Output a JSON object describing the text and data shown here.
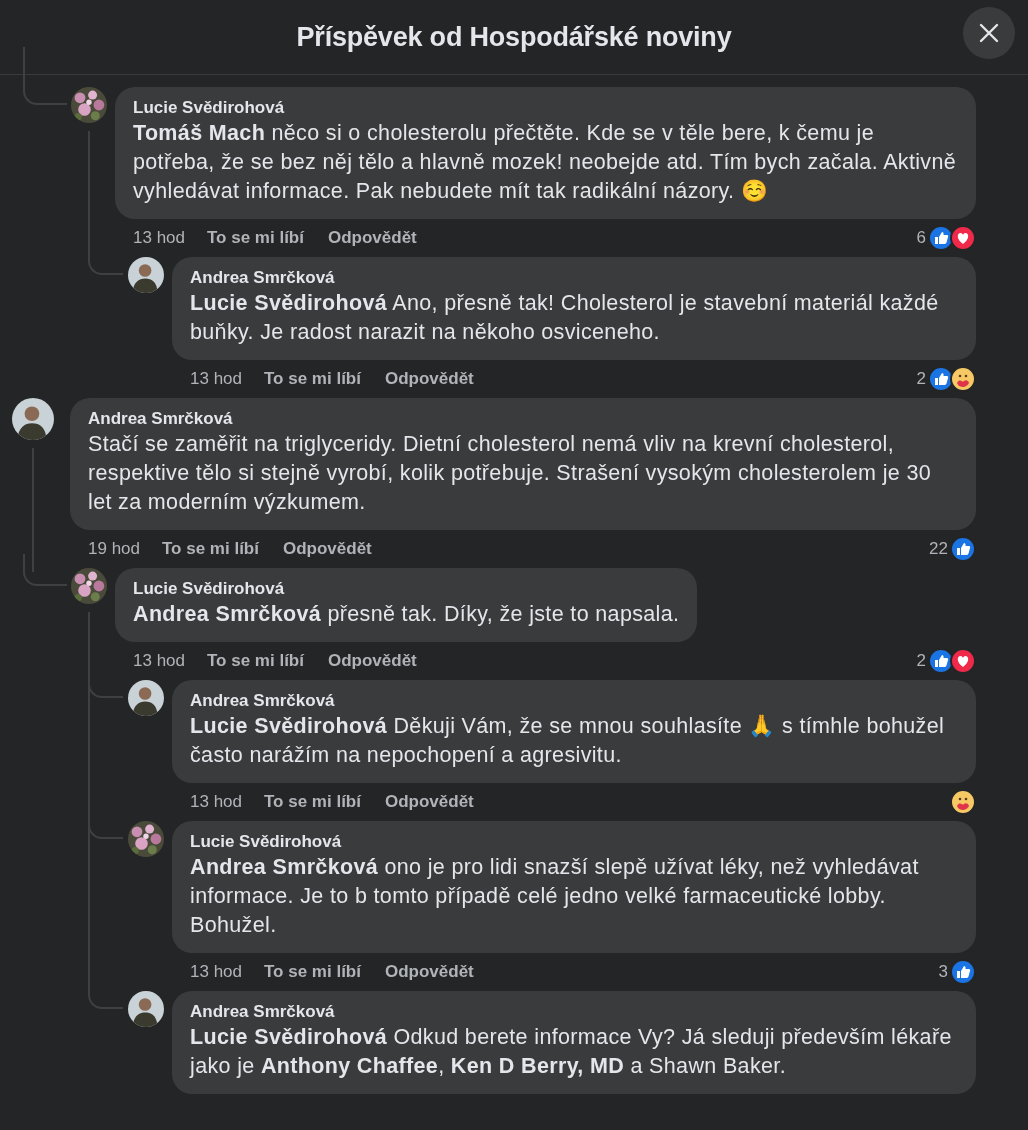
{
  "header": {
    "title": "Příspěvek od Hospodářské noviny"
  },
  "comments": [
    {
      "kind": "continued",
      "children": [
        {
          "kind": "comment",
          "avatar": {
            "kind": "flowers"
          },
          "author": "Lucie Svědirohová",
          "text": "**Tomáš Mach** něco si o cholesterolu přečtěte. Kde se v těle bere, k čemu je potřeba, že se bez něj tělo a hlavně mozek! neobejde atd. Tím bych začala. Aktivně vyhledávat informace. Pak nebudete mít tak radikální názory. ☺️",
          "time": "13 hod",
          "like": "To se mi líbí",
          "reply": "Odpovědět",
          "count": "6",
          "reactions": [
            {
              "kind": "like"
            },
            {
              "kind": "love"
            }
          ],
          "children": [
            {
              "kind": "comment",
              "avatar": {
                "kind": "person"
              },
              "author": "Andrea Smrčková",
              "text": "**Lucie Svědirohová** Ano, přesně tak! Cholesterol je stavební materiál každé buňky. Je radost narazit na někoho osviceneho.",
              "time": "13 hod",
              "like": "To se mi líbí",
              "reply": "Odpovědět",
              "count": "2",
              "reactions": [
                {
                  "kind": "like"
                },
                {
                  "kind": "care"
                }
              ]
            }
          ]
        }
      ]
    },
    {
      "kind": "comment",
      "avatar": {
        "kind": "person"
      },
      "author": "Andrea Smrčková",
      "text": "Stačí se zaměřit na triglyceridy. Dietní cholesterol nemá vliv na krevní cholesterol, respektive tělo si stejně vyrobí, kolik potřebuje. Strašení vysokým cholesterolem je 30 let za moderním výzkumem.",
      "time": "19 hod",
      "like": "To se mi líbí",
      "reply": "Odpovědět",
      "count": "22",
      "reactions": [
        {
          "kind": "like"
        }
      ],
      "children": [
        {
          "kind": "comment",
          "avatar": {
            "kind": "flowers"
          },
          "author": "Lucie Svědirohová",
          "text": "**Andrea Smrčková** přesně tak. Díky, že jste to napsala.",
          "time": "13 hod",
          "like": "To se mi líbí",
          "reply": "Odpovědět",
          "count": "2",
          "reactions": [
            {
              "kind": "like"
            },
            {
              "kind": "love"
            }
          ],
          "children": [
            {
              "kind": "comment",
              "avatar": {
                "kind": "person"
              },
              "author": "Andrea Smrčková",
              "text": "**Lucie Svědirohová** Děkuji Vám, že se mnou souhlasíte 🙏 s tímhle bohužel často narážím na nepochopení a agresivitu.",
              "time": "13 hod",
              "like": "To se mi líbí",
              "reply": "Odpovědět",
              "reactions": [
                {
                  "kind": "care"
                }
              ]
            },
            {
              "kind": "comment",
              "avatar": {
                "kind": "flowers"
              },
              "author": "Lucie Svědirohová",
              "text": "**Andrea Smrčková** ono je pro lidi snazší slepě užívat léky, než vyhledávat informace. Je to b tomto případě celé jedno velké farmaceutické lobby. Bohužel.",
              "time": "13 hod",
              "like": "To se mi líbí",
              "reply": "Odpovědět",
              "count": "3",
              "reactions": [
                {
                  "kind": "like"
                }
              ]
            },
            {
              "kind": "comment",
              "avatar": {
                "kind": "person"
              },
              "author": "Andrea Smrčková",
              "text": "**Lucie Svědirohová** Odkud berete informace Vy? Já sleduji především lékaře jako je **Anthony Chaffee**, **Ken D Berry, MD** a Shawn Baker."
            }
          ]
        }
      ]
    }
  ]
}
